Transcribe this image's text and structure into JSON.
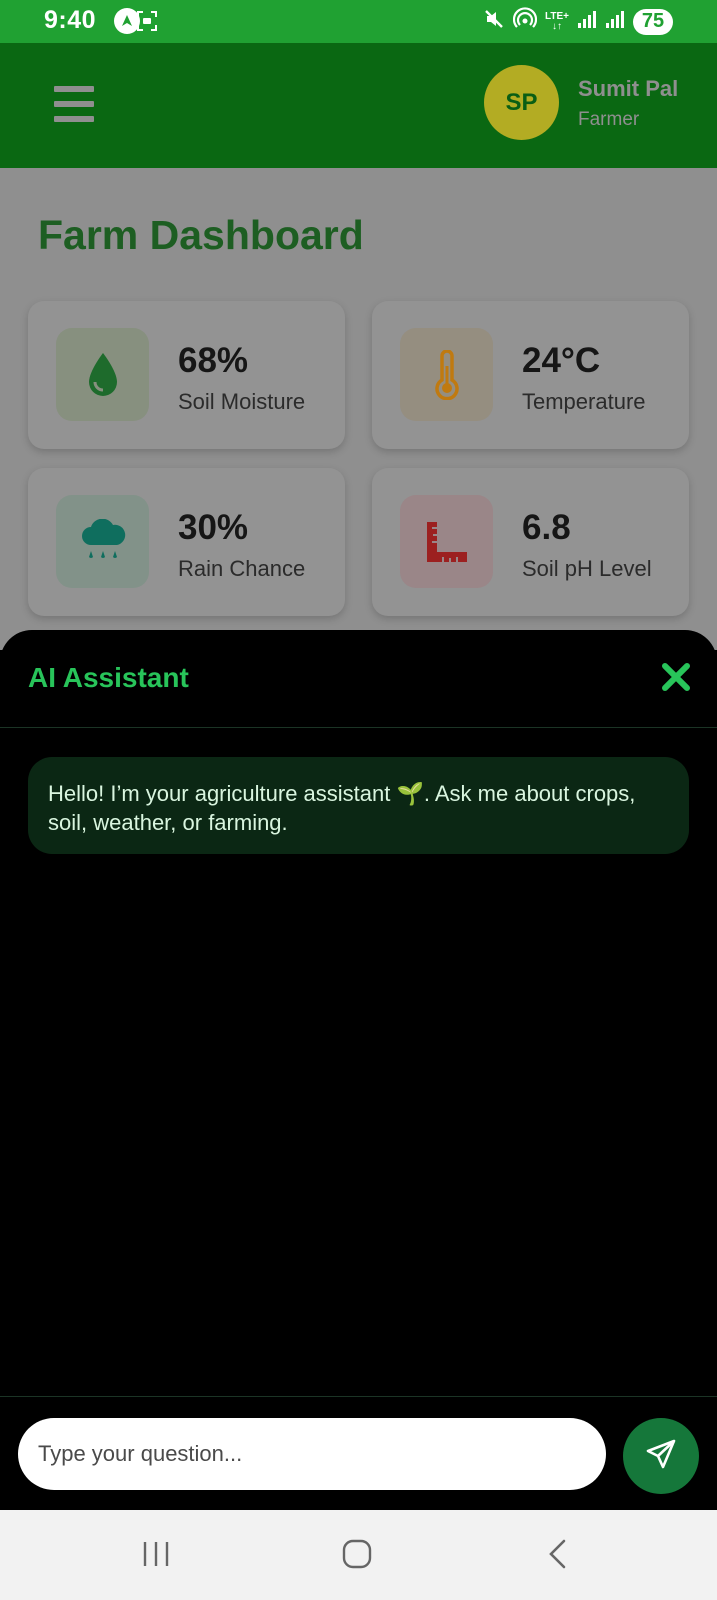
{
  "status_bar": {
    "time": "9:40",
    "network": "LTE+",
    "battery": "75",
    "icons": [
      "navigation-icon",
      "screenshot-icon",
      "mute-icon",
      "hotspot-icon",
      "signal-icon",
      "signal-icon"
    ]
  },
  "header": {
    "avatar_initials": "SP",
    "user_name": "Sumit Pal",
    "user_role": "Farmer",
    "menu_icon": "hamburger-icon"
  },
  "dashboard": {
    "title": "Farm Dashboard",
    "cards": [
      {
        "value": "68%",
        "label": "Soil Moisture",
        "icon": "water-drop-icon",
        "color": "#1e6b2c"
      },
      {
        "value": "24°C",
        "label": "Temperature",
        "icon": "thermometer-icon",
        "color": "#c07a10"
      },
      {
        "value": "30%",
        "label": "Rain Chance",
        "icon": "rain-cloud-icon",
        "color": "#0f6e5e"
      },
      {
        "value": "6.8",
        "label": "Soil pH Level",
        "icon": "ruler-icon",
        "color": "#9c2020"
      }
    ]
  },
  "assistant": {
    "title": "AI Assistant",
    "message": "Hello! I’m your agriculture assistant 🌱. Ask me about crops, soil, weather, or farming.",
    "input_placeholder": "Type your question...",
    "close_icon": "close-icon",
    "send_icon": "send-icon"
  },
  "colors": {
    "status_bar": "#20a132",
    "header": "#0a6812",
    "accent": "#28c45a",
    "send_button": "#15773a"
  }
}
